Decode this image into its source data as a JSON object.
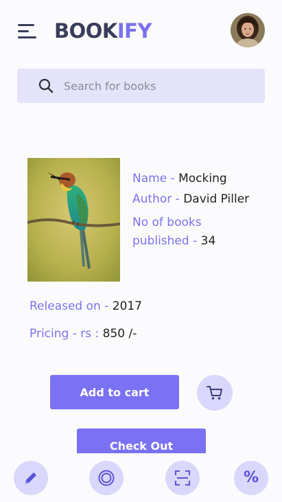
{
  "header": {
    "logo_part1": "BOOK",
    "logo_part2": "IFY"
  },
  "search": {
    "placeholder": "Search for books",
    "value": ""
  },
  "book": {
    "name_label": "Name -",
    "name": "Mocking",
    "author_label": "Author -",
    "author": "David Piller",
    "published_label_line1": "No of books",
    "published_label_line2": "published -",
    "published_count": "34",
    "released_label": "Released on -",
    "released": "2017",
    "pricing_label": "Pricing - rs :",
    "price": "850 /-"
  },
  "actions": {
    "add_to_cart": "Add to cart",
    "check_out": "Check Out"
  },
  "bottom_nav": {
    "discount_symbol": "%",
    "icons": [
      "pencil-icon",
      "target-icon",
      "scan-icon",
      "percent-icon"
    ]
  },
  "colors": {
    "accent": "#7b71f5",
    "accent_text": "#7b71ee",
    "accent_light": "#d9d7fc",
    "search_bg": "#e4e3fa",
    "logo_dark": "#3a3d5c"
  }
}
